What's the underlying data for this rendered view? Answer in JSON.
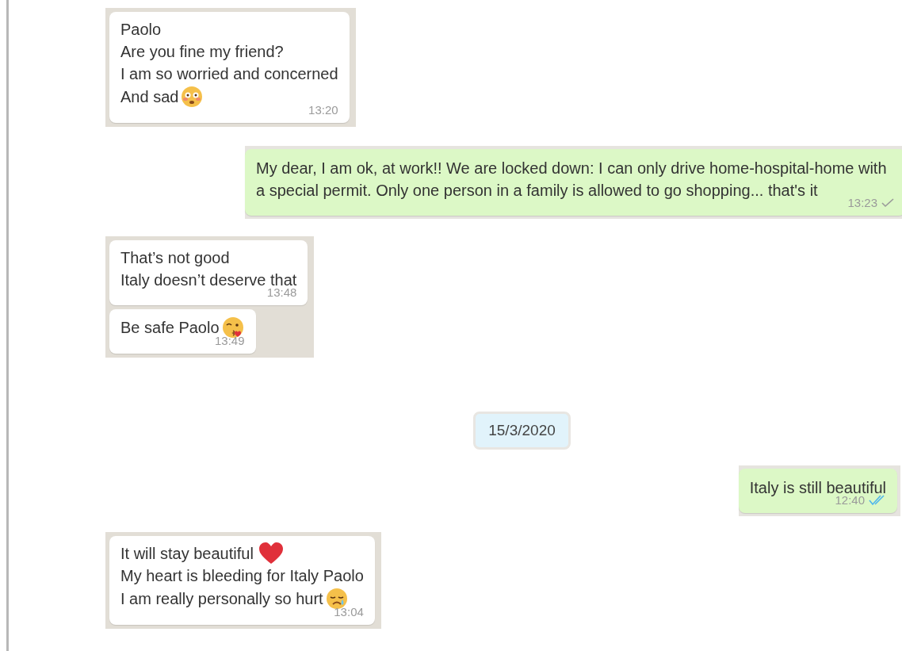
{
  "messages": [
    {
      "kind": "incoming",
      "bubbles": [
        {
          "lines": [
            {
              "text": "Paolo"
            },
            {
              "text": "Are you fine my friend?"
            },
            {
              "text": "I am so worried and concerned"
            },
            {
              "text": "And sad",
              "kind": "flushed-emoji"
            }
          ],
          "time": "13:20"
        }
      ]
    },
    {
      "kind": "outgoing",
      "bubbles": [
        {
          "lines": [
            {
              "text": "My dear, I am ok, at work!!  We are locked down: I can only drive home-hospital-home with a special permit. Only one person in a family is allowed to go shopping... that's it"
            }
          ],
          "time": "13:23",
          "read": false
        }
      ]
    },
    {
      "kind": "incoming",
      "bubbles": [
        {
          "lines": [
            {
              "text": "That’s not good"
            },
            {
              "text": "Italy doesn’t deserve that"
            }
          ],
          "time": "13:48"
        },
        {
          "lines": [
            {
              "text": "Be safe Paolo",
              "kind": "kiss-emoji"
            }
          ],
          "time": "13:49"
        }
      ]
    },
    {
      "kind": "date",
      "text": "15/3/2020"
    },
    {
      "kind": "outgoing",
      "bubbles": [
        {
          "lines": [
            {
              "text": "Italy is still beautiful"
            }
          ],
          "time": "12:40",
          "read": true
        }
      ]
    },
    {
      "kind": "incoming",
      "bubbles": [
        {
          "lines": [
            {
              "text": "It will stay beautiful",
              "kind": "heart-emoji"
            },
            {
              "text": "My heart is bleeding for Italy Paolo"
            },
            {
              "text": "I am really personally so hurt",
              "kind": "crying-emoji"
            }
          ],
          "time": "13:04"
        }
      ]
    }
  ]
}
